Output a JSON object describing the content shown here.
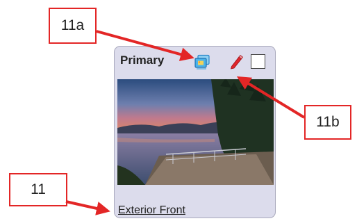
{
  "card": {
    "title": "Primary",
    "caption": "Exterior Front"
  },
  "callouts": {
    "gallery": "11a",
    "edit": "11b",
    "caption": "11"
  },
  "colors": {
    "callout_border": "#e32626",
    "arrow": "#e32626",
    "card_background": "#dcdcec"
  },
  "icons": [
    "image-gallery-icon",
    "pencil-edit-icon",
    "checkbox"
  ]
}
